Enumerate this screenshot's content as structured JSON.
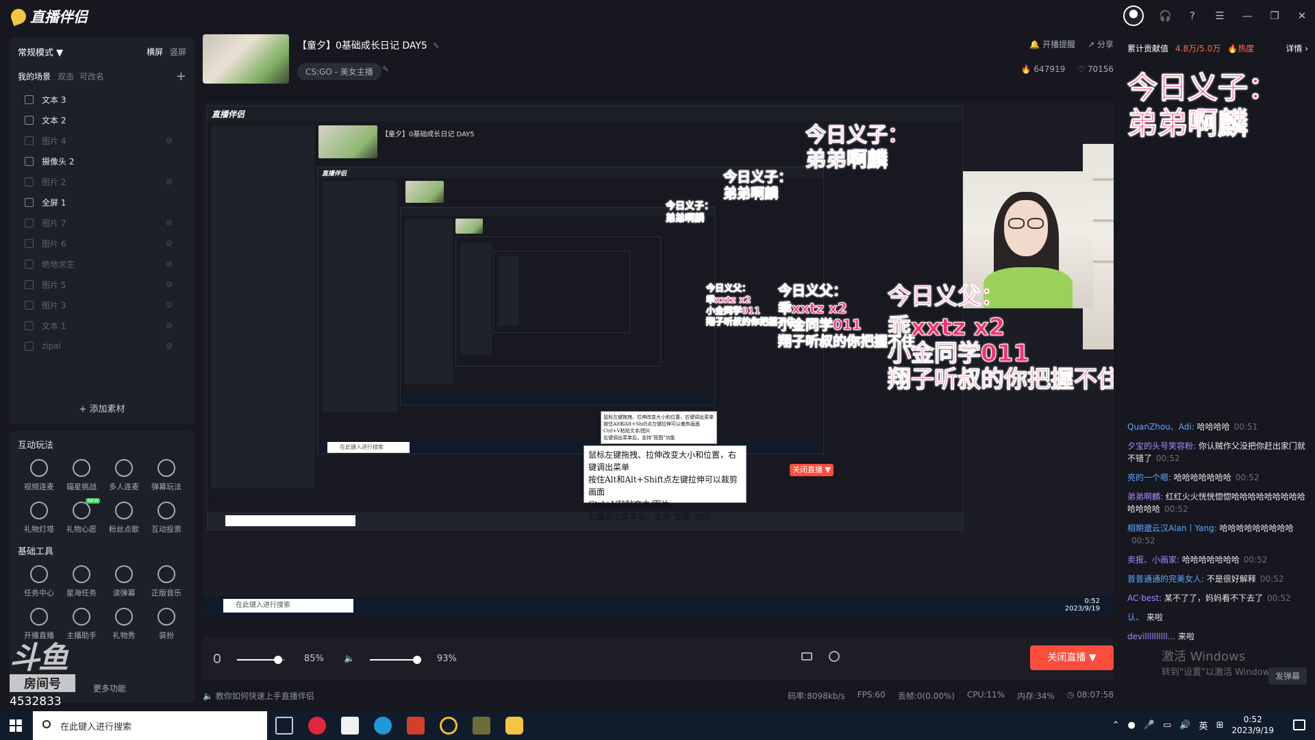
{
  "app": {
    "logo_text": "直播伴侣"
  },
  "sidebar": {
    "mode": "常规模式 ▼",
    "orient_landscape": "横屏",
    "orient_portrait": "竖屏",
    "my_scenes": "我的场景",
    "hint_dblclick": "双击",
    "hint_rename": "可改名",
    "add_plus": "+",
    "scenes": [
      {
        "label": "文本 3",
        "active": true
      },
      {
        "label": "文本 2",
        "active": true
      },
      {
        "label": "图片 4",
        "active": false
      },
      {
        "label": "摄像头 2",
        "active": true
      },
      {
        "label": "图片 2",
        "active": false
      },
      {
        "label": "全屏 1",
        "active": true
      },
      {
        "label": "图片 7",
        "active": false
      },
      {
        "label": "图片 6",
        "active": false
      },
      {
        "label": "绝地求生",
        "active": false
      },
      {
        "label": "图片 5",
        "active": false
      },
      {
        "label": "图片 3",
        "active": false
      },
      {
        "label": "文本 1",
        "active": false
      },
      {
        "label": "zipai",
        "active": false
      }
    ],
    "add_material": "+ 添加素材",
    "interactive_title": "互动玩法",
    "interactive": [
      {
        "label": "视频连麦",
        "icon": "mic-icon"
      },
      {
        "label": "辐星挑战",
        "icon": "shield-icon"
      },
      {
        "label": "多人连麦",
        "icon": "multi-mic-icon"
      },
      {
        "label": "弹幕玩法",
        "icon": "download-icon"
      },
      {
        "label": "礼物灯塔",
        "icon": "download-icon"
      },
      {
        "label": "礼物心愿",
        "icon": "gift-icon",
        "badge": "NEW"
      },
      {
        "label": "粉丝点歌",
        "icon": "music-icon"
      },
      {
        "label": "互动投票",
        "icon": "download-icon"
      }
    ],
    "basic_title": "基础工具",
    "basic": [
      {
        "label": "任务中心",
        "icon": "task-icon"
      },
      {
        "label": "星海任务",
        "icon": "ad-icon"
      },
      {
        "label": "读弹幕",
        "icon": "read-icon"
      },
      {
        "label": "正版音乐",
        "icon": "download-icon"
      },
      {
        "label": "开播直播",
        "icon": "tv-icon"
      },
      {
        "label": "主播助手",
        "icon": "assistant-icon"
      },
      {
        "label": "礼物秀",
        "icon": "tv-icon"
      },
      {
        "label": "装扮",
        "icon": "smile-icon"
      }
    ],
    "more": "更多功能",
    "watermark_logo": "斗鱼",
    "watermark_room": "房间号",
    "watermark_id": "4532833"
  },
  "header": {
    "title": "【童夕】0基础成长日记 DAY5",
    "category": "CS:GO - 美女主播",
    "remind": "开播提醒",
    "share": "分享",
    "heat": "647919",
    "likes": "70156"
  },
  "preview": {
    "overlay_daughter_title": "今日义子：",
    "overlay_daughter_name": "弟弟啊麟",
    "overlay_father_title": "今日义父：",
    "overlay_father_lines": [
      "乖xxtz x2",
      "小金同学011",
      "翔子听叔的你把握不住"
    ],
    "tooltip_lines": [
      "鼠标左键拖拽、拉伸改变大小和位置，右键调出菜单",
      "按住Alt和Alt+Shift点左键拉伸可以裁剪画面",
      "Ctrl+V粘贴文本/图片",
      "右键调出菜单后，支持\"抠图\"功能"
    ],
    "mini_close": "关闭直播 ▼",
    "mini_search": "在此键入进行搜索",
    "mini_time": "0:52",
    "mini_date": "2023/9/19"
  },
  "controls": {
    "mic_volume": "85%",
    "speaker_volume": "93%",
    "mic_level": 0.85,
    "speaker_level": 0.93,
    "close_live": "关闭直播 ▼"
  },
  "status": {
    "tip": "教你如何快速上手直播伴侣",
    "bitrate": "码率:8098kb/s",
    "fps": "FPS:60",
    "drop": "丢帧:0(0.00%)",
    "cpu": "CPU:11%",
    "mem": "内存:34%",
    "duration": "08:07:58"
  },
  "right": {
    "contrib_label": "累计贡献值",
    "contrib_value": "4.8万/5.0万",
    "hot": "热度",
    "detail": "详情 ›",
    "overlay_title": "今日义子：",
    "overlay_name": "弟弟啊麟",
    "chat": [
      {
        "user": "QuanZhou、Adi:",
        "text": "哈哈哈哈",
        "time": "00:51"
      },
      {
        "user": "夕宝的头号笑容粉:",
        "text": "你认贼作父没把你赶出家门就不错了",
        "time": "00:52"
      },
      {
        "user": "亮的一个嗯:",
        "text": "哈哈哈哈哈哈哈",
        "time": "00:52"
      },
      {
        "user": "弟弟啊麟:",
        "text": "红红火火恍恍惚惚哈哈哈哈哈哈哈哈哈哈哈哈哈",
        "time": "00:52"
      },
      {
        "user": "相期邈云汉Alan丨Yang:",
        "text": "哈哈哈哈哈哈哈哈哈",
        "time": "00:52"
      },
      {
        "user": "卖报、小画家:",
        "text": "哈哈哈哈哈哈哈",
        "time": "00:52"
      },
      {
        "user": "普普通通的完美女人:",
        "text": "不是很好解释",
        "time": "00:52"
      },
      {
        "user": "AC·best:",
        "text": "某不了了，妈妈看不下去了",
        "time": "00:52"
      },
      {
        "user": "认、",
        "text": "来啦",
        "time": ""
      },
      {
        "user": "devillllllllll...",
        "text": "来啦",
        "time": ""
      }
    ],
    "activate": "激活 Windows",
    "activate_sub": "转到\"设置\"以激活 Windows。",
    "danmu_btn": "发弹幕"
  },
  "taskbar": {
    "search": "在此键入进行搜索",
    "lang": "英",
    "time": "0:52",
    "date": "2023/9/19"
  },
  "colors": {
    "accent": "#ff4d3d",
    "overlay_pink": "#ff2d6e",
    "bg": "#17181f"
  }
}
